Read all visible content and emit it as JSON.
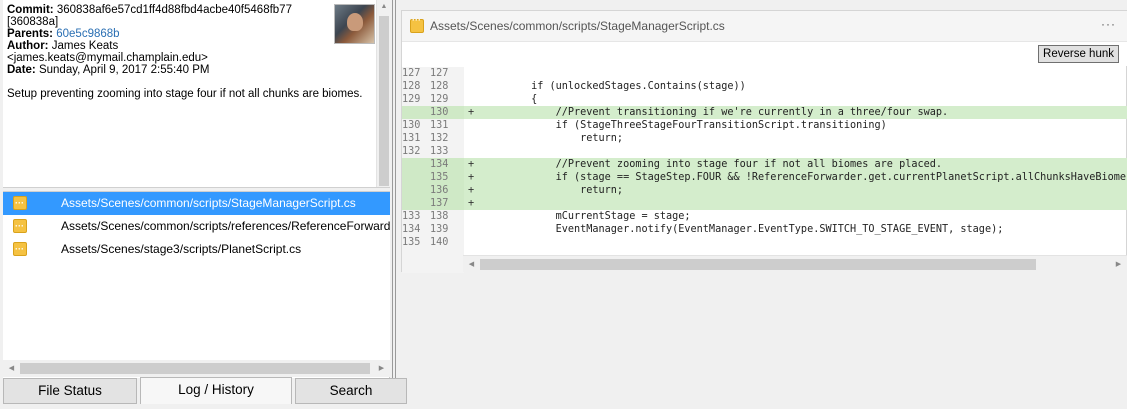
{
  "commit": {
    "commit_label": "Commit:",
    "commit_hash": "360838af6e57cd1ff4d88fbd4acbe40f5468fb77",
    "commit_short": "[360838a]",
    "parents_label": "Parents:",
    "parents_value": "60e5c9868b",
    "author_label": "Author:",
    "author_name": "James Keats",
    "author_email": "<james.keats@mymail.champlain.edu>",
    "date_label": "Date:",
    "date_value": "Sunday, April 9, 2017 2:55:40 PM",
    "message": "Setup preventing zooming into stage four if not all chunks are biomes."
  },
  "files": [
    {
      "path": "Assets/Scenes/common/scripts/StageManagerScript.cs",
      "selected": true
    },
    {
      "path": "Assets/Scenes/common/scripts/references/ReferenceForwarder.cs",
      "selected": false
    },
    {
      "path": "Assets/Scenes/stage3/scripts/PlanetScript.cs",
      "selected": false
    }
  ],
  "tabs": [
    {
      "label": "File Status"
    },
    {
      "label": "Log / History"
    },
    {
      "label": "Search"
    }
  ],
  "diff": {
    "path": "Assets/Scenes/common/scripts/StageManagerScript.cs",
    "more_label": "···",
    "reverse_hunk_label": "Reverse hunk",
    "lines": [
      {
        "old": "127",
        "new": "127",
        "mark": "",
        "text": "",
        "added": false
      },
      {
        "old": "128",
        "new": "128",
        "mark": "",
        "text": "        if (unlockedStages.Contains(stage))",
        "added": false
      },
      {
        "old": "129",
        "new": "129",
        "mark": "",
        "text": "        {",
        "added": false
      },
      {
        "old": "",
        "new": "130",
        "mark": "+",
        "text": "            //Prevent transitioning if we're currently in a three/four swap.",
        "added": true
      },
      {
        "old": "130",
        "new": "131",
        "mark": "",
        "text": "            if (StageThreeStageFourTransitionScript.transitioning)",
        "added": false
      },
      {
        "old": "131",
        "new": "132",
        "mark": "",
        "text": "                return;",
        "added": false
      },
      {
        "old": "132",
        "new": "133",
        "mark": "",
        "text": "",
        "added": false
      },
      {
        "old": "",
        "new": "134",
        "mark": "+",
        "text": "            //Prevent zooming into stage four if not all biomes are placed.",
        "added": true
      },
      {
        "old": "",
        "new": "135",
        "mark": "+",
        "text": "            if (stage == StageStep.FOUR && !ReferenceForwarder.get.currentPlanetScript.allChunksHaveBiomes",
        "added": true
      },
      {
        "old": "",
        "new": "136",
        "mark": "+",
        "text": "                return;",
        "added": true
      },
      {
        "old": "",
        "new": "137",
        "mark": "+",
        "text": "",
        "added": true
      },
      {
        "old": "133",
        "new": "138",
        "mark": "",
        "text": "            mCurrentStage = stage;",
        "added": false
      },
      {
        "old": "134",
        "new": "139",
        "mark": "",
        "text": "            EventManager.notify(EventManager.EventType.SWITCH_TO_STAGE_EVENT, stage);",
        "added": false
      },
      {
        "old": "135",
        "new": "140",
        "mark": "",
        "text": "",
        "added": false
      }
    ]
  },
  "colors": {
    "selection": "#3399ff",
    "added_line": "#d4edcc",
    "link": "#2a6fb3"
  }
}
